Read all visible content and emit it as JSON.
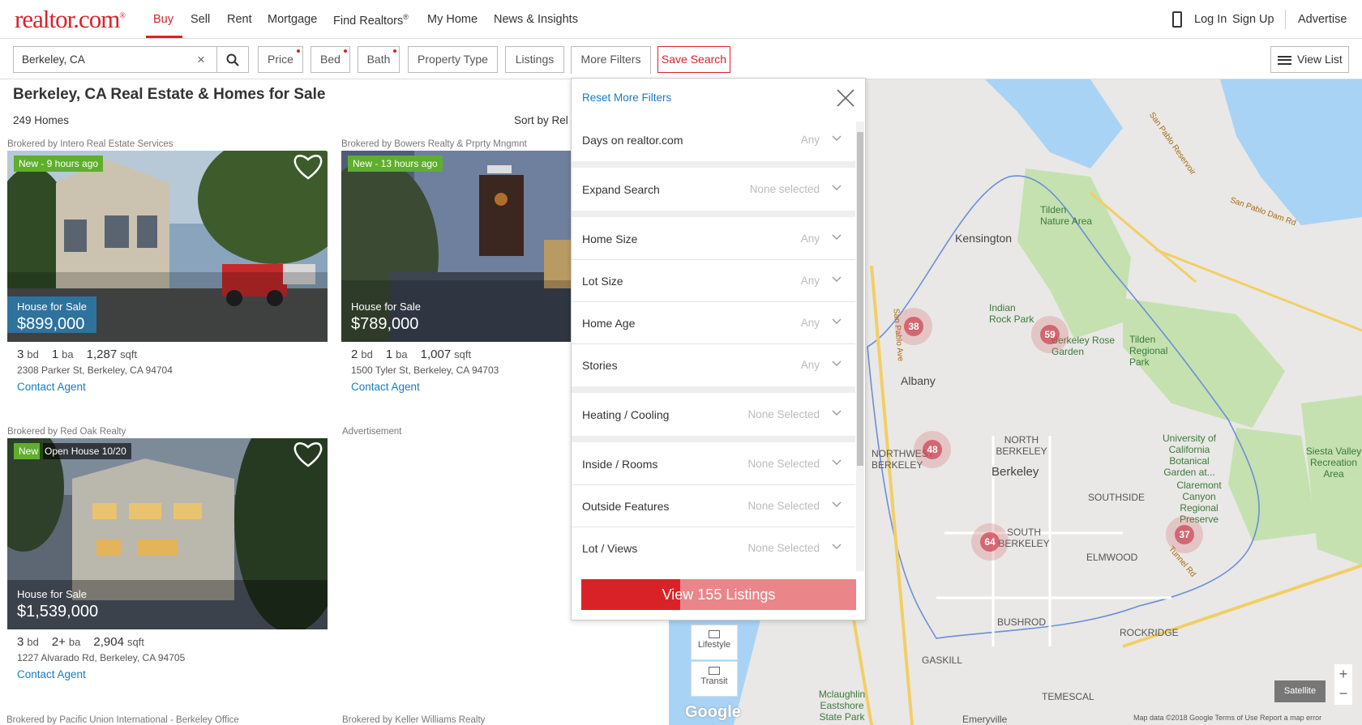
{
  "nav": {
    "logo": "realtor.com",
    "logo_mark": "®",
    "items": [
      "Buy",
      "Sell",
      "Rent",
      "Mortgage",
      "Find Realtors",
      "My Home",
      "News & Insights"
    ],
    "find_realtors_mark": "®",
    "login": "Log In",
    "signup": "Sign Up",
    "advertise": "Advertise"
  },
  "search": {
    "value": "Berkeley, CA",
    "clear": "×"
  },
  "filters": {
    "price": "Price",
    "bed": "Bed",
    "bath": "Bath",
    "property_type": "Property Type",
    "listings": "Listings",
    "more_filters": "More Filters",
    "save_search": "Save Search",
    "view_list": "View List"
  },
  "results": {
    "title": "Berkeley, CA Real Estate & Homes for Sale",
    "count": "249 Homes",
    "sort_label": "Sort by  Rel"
  },
  "listings": [
    {
      "broker": "Brokered by Intero Real Estate Services",
      "badge": "New - 9 hours ago",
      "type": "House for Sale",
      "price": "$899,000",
      "beds": "3",
      "bed_unit": "bd",
      "baths": "1",
      "bath_unit": "ba",
      "sqft": "1,287",
      "sqft_unit": "sqft",
      "address": "2308 Parker St, Berkeley, CA 94704",
      "contact": "Contact Agent"
    },
    {
      "broker": "Brokered by Bowers Realty & Prprty Mngmnt",
      "badge": "New - 13 hours ago",
      "type": "House for Sale",
      "price": "$789,000",
      "beds": "2",
      "bed_unit": "bd",
      "baths": "1",
      "bath_unit": "ba",
      "sqft": "1,007",
      "sqft_unit": "sqft",
      "address": "1500 Tyler St, Berkeley, CA 94703",
      "contact": "Contact Agent"
    },
    {
      "broker": "Brokered by Red Oak Realty",
      "badge": "New",
      "badge2": "Open House 10/20",
      "type": "House for Sale",
      "price": "$1,539,000",
      "beds": "3",
      "bed_unit": "bd",
      "baths": "2+",
      "bath_unit": "ba",
      "sqft": "2,904",
      "sqft_unit": "sqft",
      "address": "1227 Alvarado Rd, Berkeley, CA 94705",
      "contact": "Contact Agent"
    }
  ],
  "advertisement_label": "Advertisement",
  "more_brokers": [
    "Brokered by Pacific Union International - Berkeley Office",
    "Brokered by Keller Williams Realty"
  ],
  "more_filters_panel": {
    "reset": "Reset More Filters",
    "rows": [
      {
        "label": "Days on realtor.com",
        "value": "Any"
      },
      {
        "label": "Expand Search",
        "value": "None selected"
      },
      {
        "label": "Home Size",
        "value": "Any"
      },
      {
        "label": "Lot Size",
        "value": "Any"
      },
      {
        "label": "Home Age",
        "value": "Any"
      },
      {
        "label": "Stories",
        "value": "Any"
      },
      {
        "label": "Heating / Cooling",
        "value": "None Selected"
      },
      {
        "label": "Inside / Rooms",
        "value": "None Selected"
      },
      {
        "label": "Outside Features",
        "value": "None Selected"
      },
      {
        "label": "Lot / Views",
        "value": "None Selected"
      }
    ],
    "view_button": "View 155 Listings"
  },
  "map": {
    "clusters": [
      "38",
      "59",
      "48",
      "64",
      "37"
    ],
    "labels": [
      "Kensington",
      "Tilden Nature Area",
      "Indian Rock Park",
      "Berkeley Rose Garden",
      "Tilden Regional Park",
      "Albany",
      "NORTH BERKELEY",
      "Berkeley",
      "SOUTHSIDE",
      "SOUTH BERKELEY",
      "ELMWOOD",
      "University of California Botanical Garden at...",
      "Claremont Canyon Regional Preserve",
      "Siesta Valley Recreation Area",
      "BUSHROD",
      "ROCKRIDGE",
      "GASKILL",
      "TEMESCAL",
      "Mclaughlin Eastshore State Park",
      "Emeryville",
      "NORTHWEST BERKELEY"
    ],
    "roads": [
      "San Pablo Reservoir",
      "San Pablo Dam Rd",
      "Tunnel Rd",
      "San Pablo Ave"
    ],
    "side_buttons": [
      "Lifestyle",
      "Transit"
    ],
    "satellite": "Satellite",
    "zoom_in": "+",
    "zoom_out": "−",
    "google": "Google",
    "credit": "Map data ©2018 Google   Terms of Use   Report a map error"
  }
}
